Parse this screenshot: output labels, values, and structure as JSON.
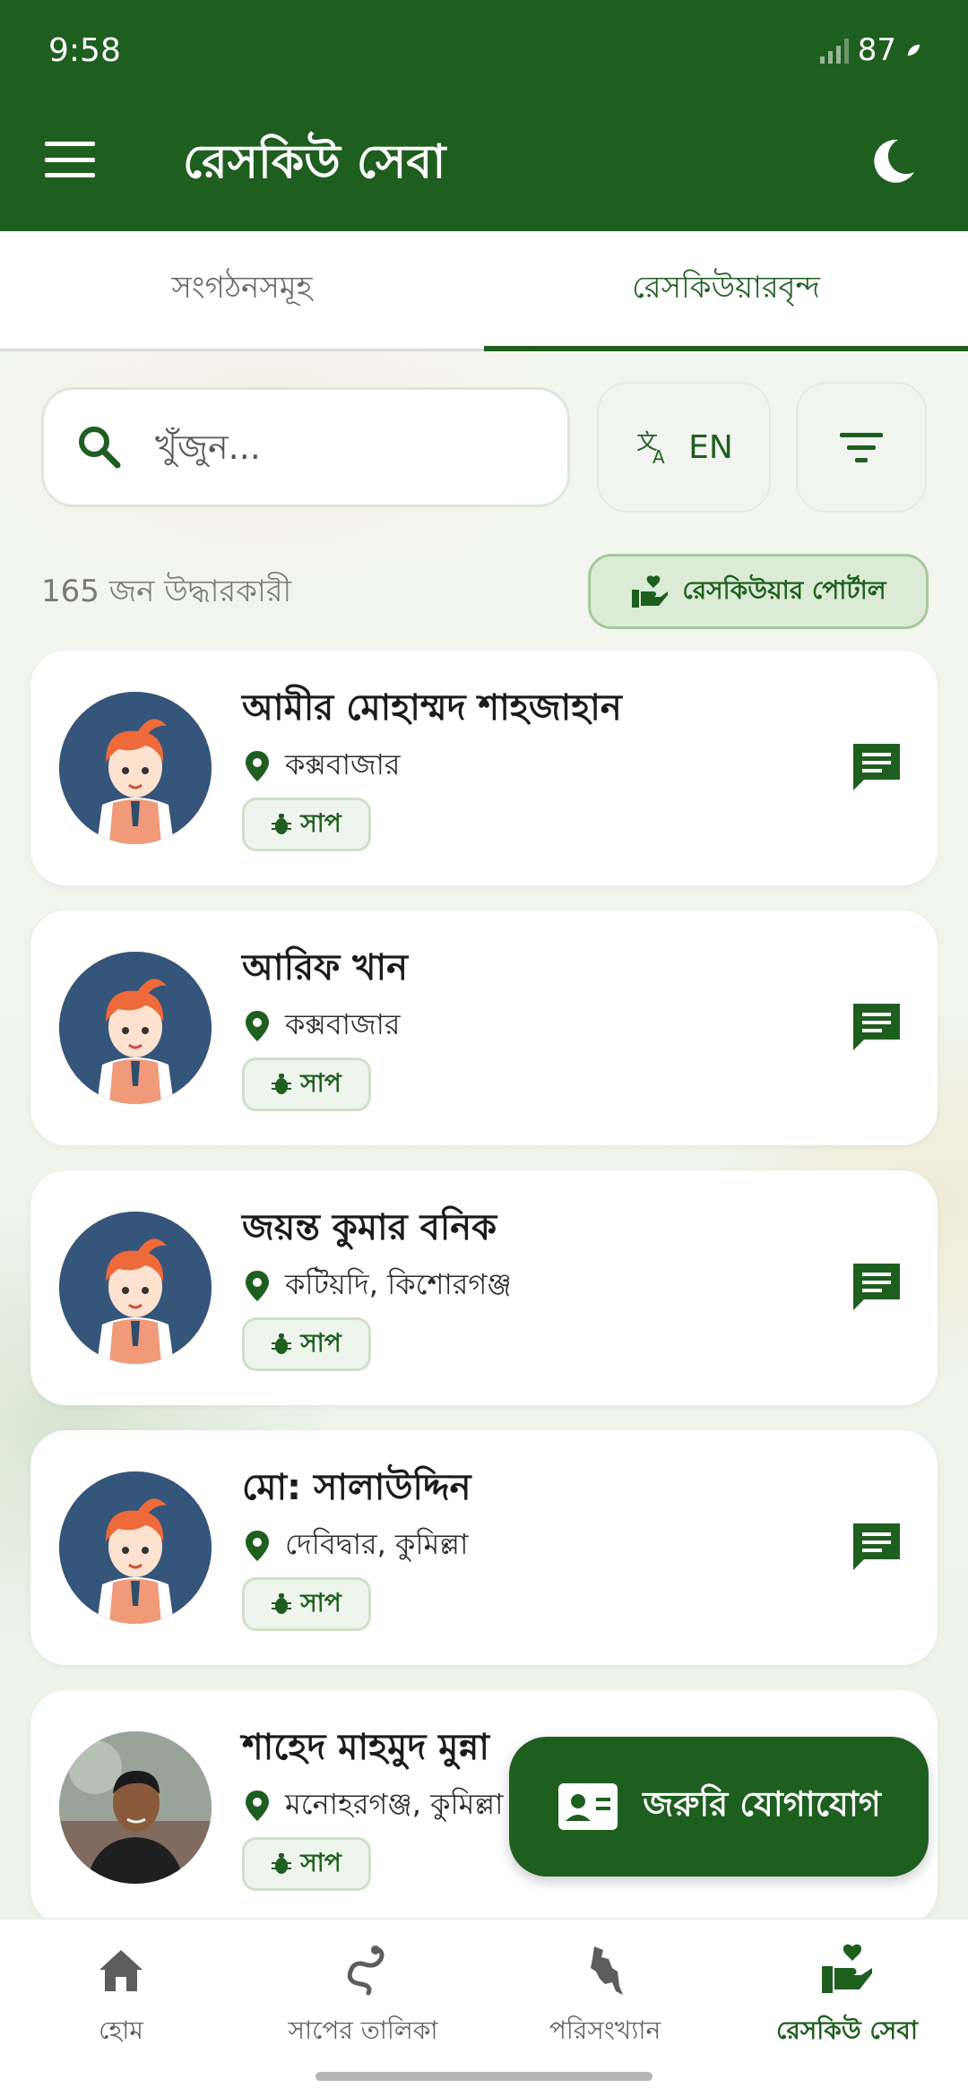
{
  "status_bar": {
    "time": "9:58",
    "battery": "87"
  },
  "app_bar": {
    "title": "রেসকিউ সেবা"
  },
  "tabs": [
    {
      "label": "সংগঠনসমূহ",
      "active": false
    },
    {
      "label": "রেসকিউয়ারবৃন্দ",
      "active": true
    }
  ],
  "search": {
    "placeholder": "খুঁজুন..."
  },
  "language_toggle": {
    "label": "EN"
  },
  "summary": {
    "count_text": "165 জন উদ্ধারকারী"
  },
  "portal_button": {
    "label": "রেসকিউয়ার পোর্টাল"
  },
  "rescuers": [
    {
      "name": "আমীর মোহাম্মদ শাহজাহান",
      "location": "কক্সবাজার",
      "tag": "সাপ",
      "avatar": "cartoon"
    },
    {
      "name": "আরিফ খান",
      "location": "কক্সবাজার",
      "tag": "সাপ",
      "avatar": "cartoon"
    },
    {
      "name": "জয়ন্ত কুমার বনিক",
      "location": "কটিয়দি, কিশোরগঞ্জ",
      "tag": "সাপ",
      "avatar": "cartoon"
    },
    {
      "name": "মো: সালাউদ্দিন",
      "location": "দেবিদ্বার, কুমিল্লা",
      "tag": "সাপ",
      "avatar": "cartoon"
    },
    {
      "name": "শাহেদ মাহমুদ মুন্না",
      "location": "মনোহরগঞ্জ, কুমিল্লা",
      "tag": "সাপ",
      "avatar": "photo"
    }
  ],
  "fab": {
    "label": "জরুরি যোগাযোগ"
  },
  "bottom_nav": [
    {
      "label": "হোম",
      "icon": "home-icon",
      "active": false
    },
    {
      "label": "সাপের তালিকা",
      "icon": "snake-icon",
      "active": false
    },
    {
      "label": "পরিসংখ্যান",
      "icon": "bangladesh-map-icon",
      "active": false
    },
    {
      "label": "রেসকিউ সেবা",
      "icon": "hand-heart-icon",
      "active": true
    }
  ],
  "colors": {
    "primary": "#1e5f1f",
    "tag_bg": "#eef5ec",
    "portal_bg": "#dcebd6"
  }
}
